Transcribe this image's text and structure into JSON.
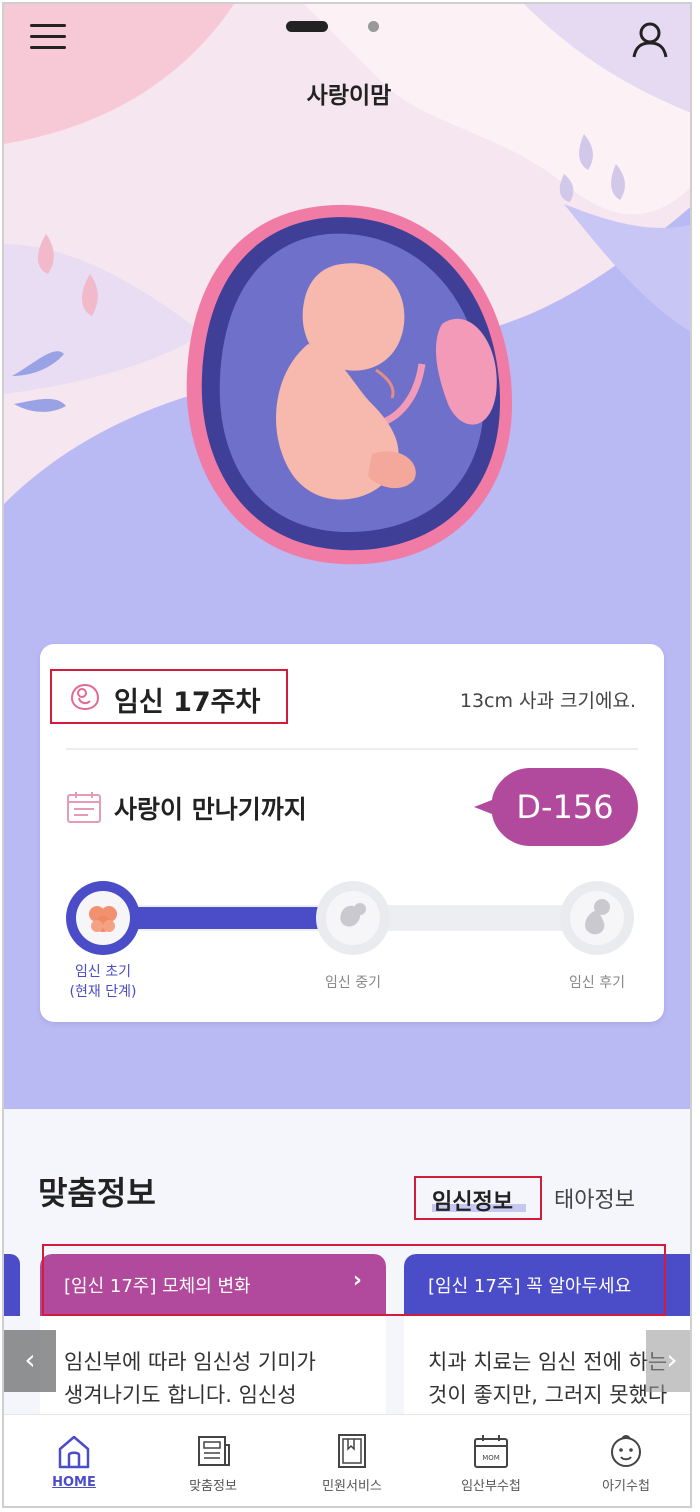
{
  "header": {
    "app_title": "사랑이맘"
  },
  "pregnancy": {
    "week_label": "임신 17주차",
    "size_text": "13cm 사과 크기에요.",
    "meet_label": "사랑이 만나기까지",
    "dday": "D-156"
  },
  "stages": [
    {
      "label": "임신 초기",
      "sublabel": "(현재 단계)",
      "state": "current"
    },
    {
      "label": "임신 중기",
      "state": "upcoming"
    },
    {
      "label": "임신 후기",
      "state": "upcoming"
    }
  ],
  "custom_info": {
    "title": "맞춤정보",
    "tabs": [
      {
        "label": "임신정보",
        "selected": true
      },
      {
        "label": "태아정보",
        "selected": false
      }
    ],
    "cards": [
      {
        "title": "[임신 17주] 모체의 변화",
        "body_line1": "임신부에 따라 임신성 기미가",
        "body_line2": "생겨나기도 합니다. 임신성"
      },
      {
        "title": "[임신 17주] 꼭 알아두세요",
        "body_line1": "치과 치료는 임신 전에 하는",
        "body_line2": "것이 좋지만, 그러지 못했다"
      }
    ]
  },
  "bottom_nav": [
    {
      "label": "HOME",
      "icon": "home-icon",
      "active": true
    },
    {
      "label": "맞춤정보",
      "icon": "newspaper-icon",
      "active": false
    },
    {
      "label": "민원서비스",
      "icon": "book-icon",
      "active": false
    },
    {
      "label": "임산부수첩",
      "icon": "calendar-mom-icon",
      "active": false
    },
    {
      "label": "아기수첩",
      "icon": "baby-face-icon",
      "active": false
    }
  ],
  "colors": {
    "primary_blue": "#4a4cc8",
    "accent_magenta": "#b14a9c",
    "hero_lavender": "#b9b9f4",
    "highlight_red": "#d21c3a"
  }
}
